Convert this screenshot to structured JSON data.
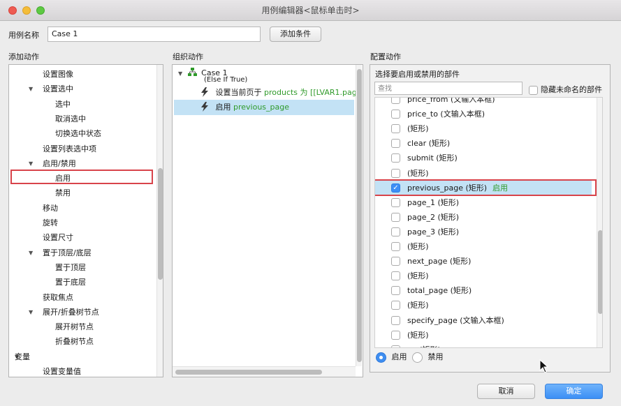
{
  "window": {
    "title": "用例编辑器<鼠标单击时>"
  },
  "case": {
    "label": "用例名称",
    "value": "Case 1",
    "add_condition": "添加条件"
  },
  "sections": {
    "add_action": "添加动作",
    "organize_action": "组织动作",
    "configure_action": "配置动作"
  },
  "left_tree": [
    {
      "label": "设置图像",
      "indent": 1,
      "caret": false
    },
    {
      "label": "设置选中",
      "indent": 1,
      "caret": true
    },
    {
      "label": "选中",
      "indent": 2,
      "caret": false
    },
    {
      "label": "取消选中",
      "indent": 2,
      "caret": false
    },
    {
      "label": "切换选中状态",
      "indent": 2,
      "caret": false
    },
    {
      "label": "设置列表选中项",
      "indent": 1,
      "caret": false
    },
    {
      "label": "启用/禁用",
      "indent": 1,
      "caret": true
    },
    {
      "label": "启用",
      "indent": 2,
      "caret": false,
      "selected": true
    },
    {
      "label": "禁用",
      "indent": 2,
      "caret": false
    },
    {
      "label": "移动",
      "indent": 1,
      "caret": false
    },
    {
      "label": "旋转",
      "indent": 1,
      "caret": false
    },
    {
      "label": "设置尺寸",
      "indent": 1,
      "caret": false
    },
    {
      "label": "置于顶层/底层",
      "indent": 1,
      "caret": true
    },
    {
      "label": "置于顶层",
      "indent": 2,
      "caret": false
    },
    {
      "label": "置于底层",
      "indent": 2,
      "caret": false
    },
    {
      "label": "获取焦点",
      "indent": 1,
      "caret": false
    },
    {
      "label": "展开/折叠树节点",
      "indent": 1,
      "caret": true
    },
    {
      "label": "展开树节点",
      "indent": 2,
      "caret": false
    },
    {
      "label": "折叠树节点",
      "indent": 2,
      "caret": false
    },
    {
      "label": "变量",
      "indent": 0,
      "caret": true
    },
    {
      "label": "设置变量值",
      "indent": 1,
      "caret": false
    }
  ],
  "organize": {
    "case_name": "Case 1",
    "case_condition": "(Else If True)",
    "action1_prefix": "设置当前页于",
    "action1_target": "products 为 [[LVAR1.pag",
    "action2_prefix": "启用",
    "action2_target": "previous_page"
  },
  "configure": {
    "title": "选择要启用或禁用的部件",
    "search_placeholder": "查找",
    "hide_unnamed": "隐藏未命名的部件",
    "widgets": [
      {
        "label": "price_from (文输入本框)",
        "checked": false,
        "partial": true
      },
      {
        "label": "price_to (文输入本框)",
        "checked": false
      },
      {
        "label": "(矩形)",
        "checked": false
      },
      {
        "label": "clear (矩形)",
        "checked": false
      },
      {
        "label": "submit (矩形)",
        "checked": false
      },
      {
        "label": "(矩形)",
        "checked": false
      },
      {
        "label": "previous_page (矩形)",
        "checked": true,
        "status": "启用"
      },
      {
        "label": "page_1 (矩形)",
        "checked": false
      },
      {
        "label": "page_2 (矩形)",
        "checked": false
      },
      {
        "label": "page_3 (矩形)",
        "checked": false
      },
      {
        "label": "(矩形)",
        "checked": false
      },
      {
        "label": "next_page (矩形)",
        "checked": false
      },
      {
        "label": "(矩形)",
        "checked": false
      },
      {
        "label": "total_page (矩形)",
        "checked": false
      },
      {
        "label": "(矩形)",
        "checked": false
      },
      {
        "label": "specify_page (文输入本框)",
        "checked": false
      },
      {
        "label": "(矩形)",
        "checked": false
      },
      {
        "label": "go (矩形)",
        "checked": false
      }
    ],
    "radio_enable": "启用",
    "radio_disable": "禁用",
    "selected_radio": "enable"
  },
  "buttons": {
    "cancel": "取消",
    "ok": "确定"
  },
  "icons": {
    "case": "flowchart-icon",
    "action": "lightning-icon",
    "cursor": "mouse-pointer-icon"
  },
  "colors": {
    "accent": "#3d8ff6",
    "highlight": "#d8434a",
    "green_text": "#2f9a2a",
    "selection": "#c3e2f5"
  }
}
